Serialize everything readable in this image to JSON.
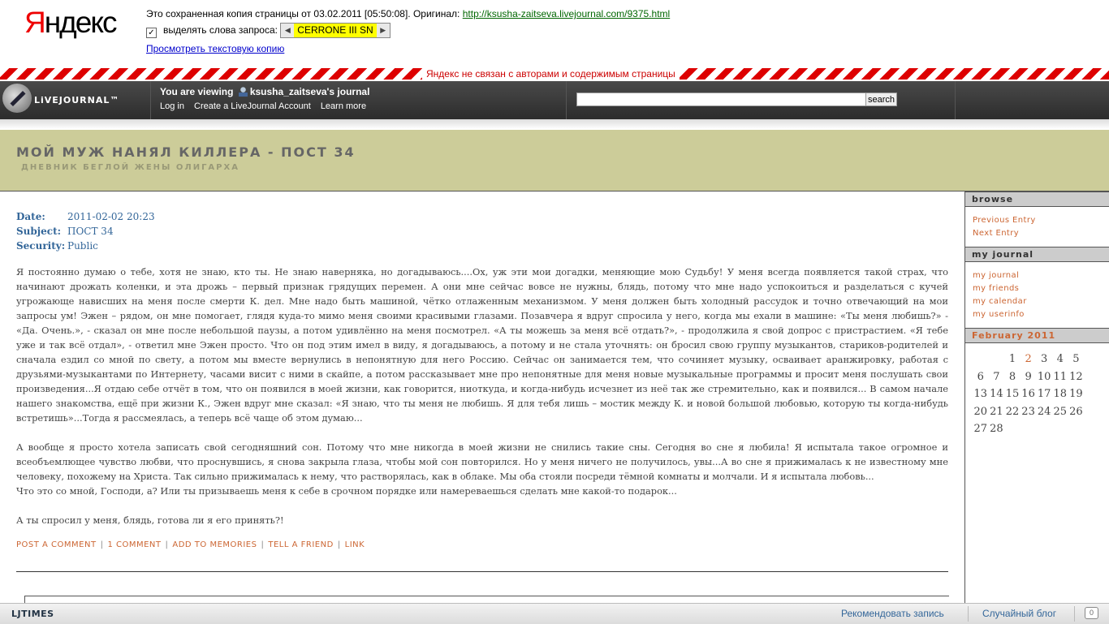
{
  "yandex": {
    "logo_ya": "Я",
    "logo_rest": "ндекс",
    "cache_text": "Это сохраненная копия страницы от 03.02.2011 [05:50:08]. Оригинал:",
    "original_url": "http://ksusha-zaitseva.livejournal.com/9375.html",
    "highlight_checkbox_checked": "✓",
    "highlight_label": "выделять слова запроса:",
    "prev_arrow": "◀",
    "query_word": "CERRONE III SN",
    "next_arrow": "▶",
    "text_copy_link": "Просмотреть текстовую копию",
    "disclaimer": "Яндекс не связан с авторами и содержимым страницы"
  },
  "ljbar": {
    "logo_text": "LiVEJOURNAL™",
    "viewing_prefix": "You are viewing",
    "username": "ksusha_zaitseva",
    "viewing_suffix": "'s journal",
    "links": [
      "Log in",
      "Create a LiveJournal Account",
      "Learn more"
    ],
    "search_value": "",
    "search_button": "search"
  },
  "journal": {
    "title": "МОЙ МУЖ НАНЯЛ КИЛЛЕРА - ПОСТ 34",
    "subtitle": "ДНЕВНИК БЕГЛОЙ ЖЕНЫ ОЛИГАРХА"
  },
  "entry": {
    "date_label": "Date:",
    "date": "2011-02-02 20:23",
    "subject_label": "Subject:",
    "subject": "ПОСТ 34",
    "security_label": "Security:",
    "security": "Public",
    "paragraphs": [
      "Я постоянно думаю о тебе, хотя не знаю, кто ты. Не знаю наверняка, но догадываюсь....Ох, уж эти мои догадки, меняющие мою Судьбу! У меня всегда появляется такой страх, что начинают дрожать коленки, и эта дрожь – первый признак грядущих перемен. А они мне сейчас вовсе не нужны, блядь, потому что мне надо успокоиться и разделаться с кучей угрожающе нависших на меня после смерти К. дел. Мне надо быть машиной, чётко отлаженным механизмом. У меня должен быть холодный рассудок и точно отвечающий на мои запросы ум! Эжен – рядом, он мне помогает, глядя куда-то мимо меня своими красивыми глазами. Позавчера я вдруг спросила у него, когда мы ехали в машине: «Ты меня любишь?» - «Да. Очень.», - сказал он мне после небольшой паузы, а потом удивлённо на меня посмотрел. «А ты можешь за меня всё отдать?», - продолжила я свой допрос с пристрастием. «Я тебе уже и так всё отдал», - ответил мне Эжен просто. Что он под этим имел в виду, я догадываюсь, а потому и не стала уточнять: он бросил свою группу музыкантов, стариков-родителей и сначала ездил со мной по свету, а потом мы вместе вернулись в непонятную для него Россию. Сейчас он занимается тем, что сочиняет музыку, осваивает аранжировку, работая с друзьями-музыкантами по Интернету, часами висит с ними в скайпе, а потом рассказывает мне про непонятные для меня новые музыкальные программы и просит меня послушать свои произведения...Я отдаю себе отчёт в том, что он появился в моей жизни, как говорится, ниоткуда, и когда-нибудь исчезнет из неё так же стремительно, как и появился... В самом начале нашего знакомства, ещё при жизни К., Эжен вдруг мне сказал: «Я знаю, что ты меня не любишь. Я для тебя лишь – мостик между К. и новой большой любовью, которую ты когда-нибудь встретишь»...Тогда я рассмеялась, а теперь всё чаще об этом думаю...",
      "А вообще я просто хотела записать свой сегодняшний сон. Потому что мне никогда в моей жизни не снились такие сны. Сегодня во сне я любила! Я испытала такое огромное и всеобъемлющее чувство любви, что проснувшись, я снова закрыла глаза, чтобы мой сон повторился. Но у меня ничего не получилось, увы...А во сне я прижималась к не известному мне человеку, похожему на Христа. Так сильно прижималась к нему, что растворялась, как в облаке. Мы оба стояли посреди тёмной комнаты и молчали. И я испытала любовь...\nЧто это со мной, Господи, а? Или ты призываешь меня к себе в срочном порядке или намереваешься сделать мне какой-то подарок...",
      "А ты спросил у меня, блядь, готова ли я его принять?!"
    ],
    "actions": [
      "POST A COMMENT",
      "1 COMMENT",
      "ADD TO MEMORIES",
      "TELL A FRIEND",
      "LINK"
    ],
    "separator": "|"
  },
  "sidebar": {
    "browse_title": "browse",
    "browse_links": [
      "Previous Entry",
      "Next Entry"
    ],
    "myjournal_title": "my journal",
    "myjournal_links": [
      "my journal",
      "my friends",
      "my calendar",
      "my userinfo"
    ],
    "calendar_title": "February 2011",
    "calendar_rows": [
      [
        "",
        "",
        "1",
        "2",
        "3",
        "4",
        "5"
      ],
      [
        "6",
        "7",
        "8",
        "9",
        "10",
        "11",
        "12"
      ],
      [
        "13",
        "14",
        "15",
        "16",
        "17",
        "18",
        "19"
      ],
      [
        "20",
        "21",
        "22",
        "23",
        "24",
        "25",
        "26"
      ],
      [
        "27",
        "28",
        "",
        "",
        "",
        "",
        ""
      ]
    ],
    "calendar_linked_day": "2"
  },
  "ljtimes": {
    "logo": "LJTIMES",
    "recommend": "Рекомендовать запись",
    "random_blog": "Случайный блог",
    "bubble": "0"
  }
}
